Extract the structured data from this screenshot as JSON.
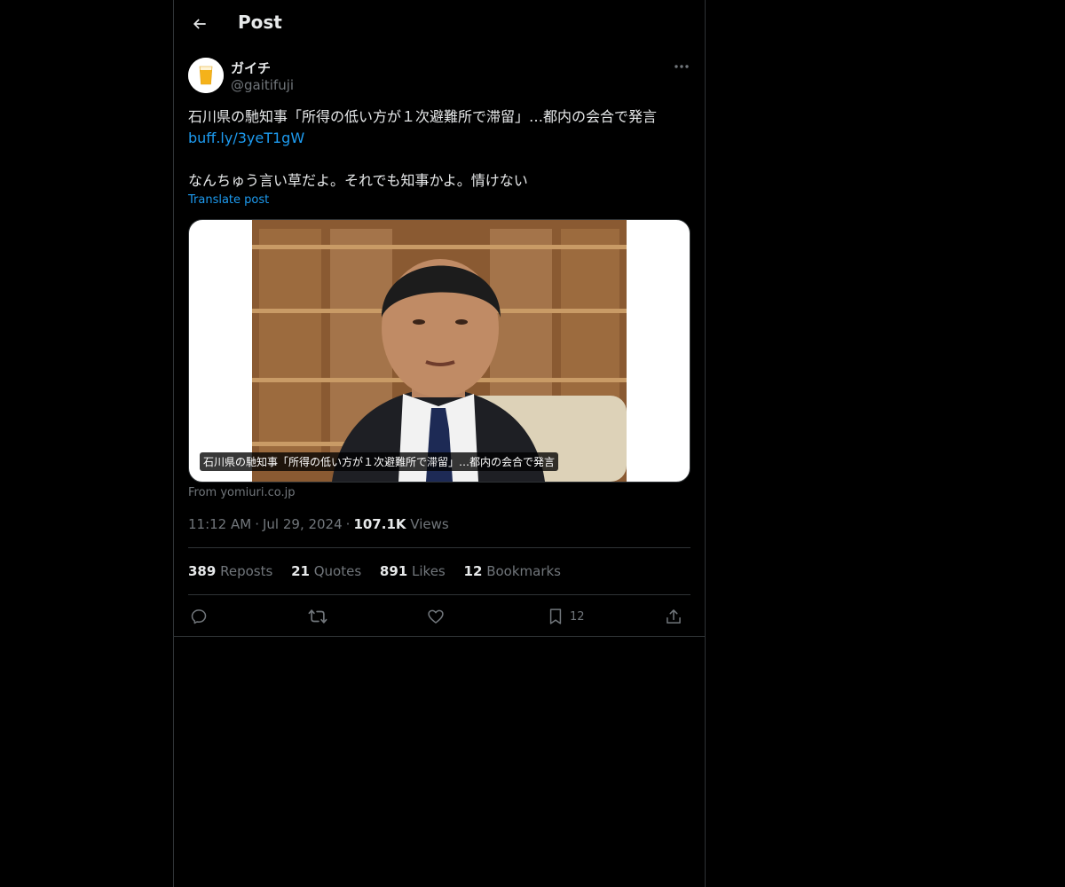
{
  "header": {
    "title": "Post"
  },
  "author": {
    "display_name": "ガイチ",
    "handle": "@gaitifuji"
  },
  "post": {
    "line1": "石川県の馳知事「所得の低い方が１次避難所で滞留」…都内の会合で発言",
    "link": "buff.ly/3yeT1gW",
    "line3": "なんちゅう言い草だよ。それでも知事かよ。情けない",
    "translate_label": "Translate post"
  },
  "card": {
    "caption": "石川県の馳知事「所得の低い方が１次避難所で滞留」…都内の会合で発言",
    "source": "From yomiuri.co.jp"
  },
  "meta": {
    "time": "11:12 AM",
    "date": "Jul 29, 2024",
    "views_count": "107.1K",
    "views_label": "Views"
  },
  "stats": {
    "reposts_count": "389",
    "reposts_label": "Reposts",
    "quotes_count": "21",
    "quotes_label": "Quotes",
    "likes_count": "891",
    "likes_label": "Likes",
    "bookmarks_count": "12",
    "bookmarks_label": "Bookmarks"
  },
  "actions": {
    "bookmark_count": "12"
  },
  "icons": {
    "back": "back-arrow-icon",
    "more": "more-icon",
    "reply": "reply-icon",
    "repost": "repost-icon",
    "like": "heart-icon",
    "bookmark": "bookmark-icon",
    "share": "share-icon"
  },
  "colors": {
    "accent": "#1d9bf0",
    "background": "#000000",
    "text": "#e7e9ea",
    "muted": "#71767b",
    "border": "#2f3336"
  }
}
